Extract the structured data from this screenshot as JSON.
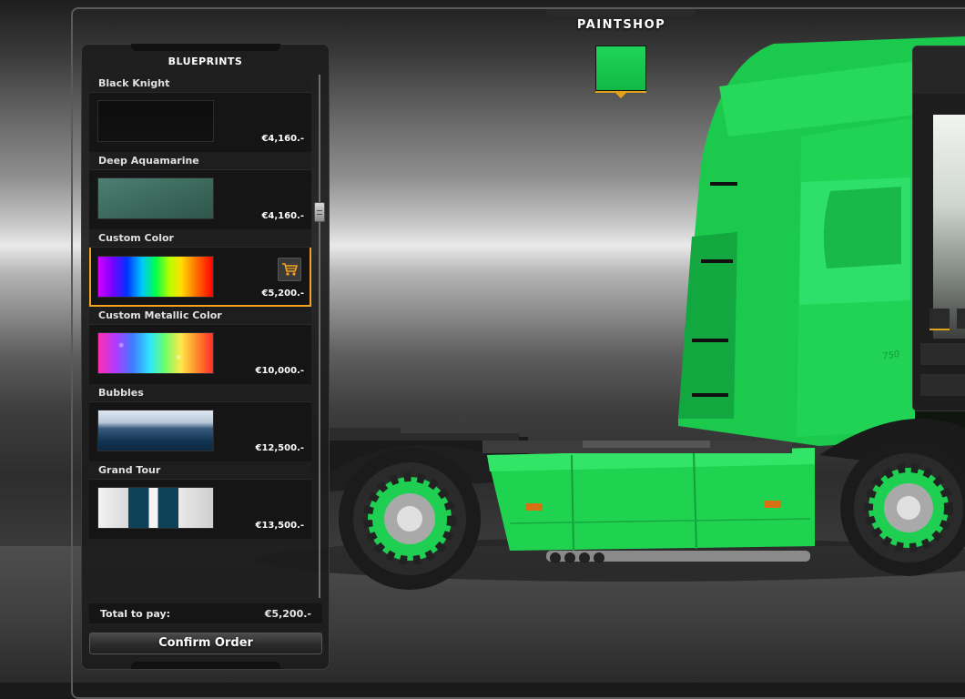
{
  "header": {
    "title": "PAINTSHOP",
    "current_color": "#19c84f",
    "accent": "#f0a31c"
  },
  "blueprints": {
    "title": "BLUEPRINTS",
    "items": [
      {
        "name": "Black Knight",
        "price": "€4,160.-",
        "thumb": "black"
      },
      {
        "name": "Deep Aquamarine",
        "price": "€4,160.-",
        "thumb": "aqua"
      },
      {
        "name": "Custom Color",
        "price": "€5,200.-",
        "thumb": "custom",
        "selected": true,
        "icon": "cart-icon"
      },
      {
        "name": "Custom Metallic Color",
        "price": "€10,000.-",
        "thumb": "metallic"
      },
      {
        "name": "Bubbles",
        "price": "€12,500.-",
        "thumb": "bubbles"
      },
      {
        "name": "Grand Tour",
        "price": "€13,500.-",
        "thumb": "grand"
      }
    ]
  },
  "footer": {
    "total_label": "Total to pay:",
    "total_value": "€5,200.-",
    "confirm_label": "Confirm Order"
  },
  "truck": {
    "paint_color": "#19c84f",
    "model_badge": "750"
  }
}
